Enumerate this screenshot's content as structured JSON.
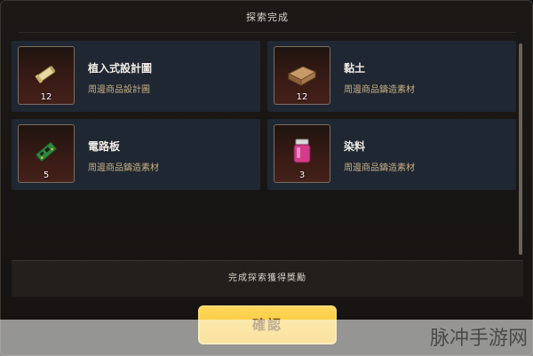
{
  "dialog": {
    "title": "探索完成"
  },
  "items": [
    {
      "name": "植入式設計圖",
      "desc": "周邊商品設計圖",
      "count": "12",
      "icon": "blueprint-scroll-icon"
    },
    {
      "name": "黏土",
      "desc": "周邊商品鑄造素材",
      "count": "12",
      "icon": "clay-block-icon"
    },
    {
      "name": "電路板",
      "desc": "周邊商品鑄造素材",
      "count": "5",
      "icon": "circuit-board-icon"
    },
    {
      "name": "染料",
      "desc": "周邊商品鑄造素材",
      "count": "3",
      "icon": "dye-bottle-icon"
    }
  ],
  "reward_bar": {
    "label": "完成探索獲得獎勵"
  },
  "confirm_button": {
    "label": "確認"
  },
  "watermark": {
    "text": "脉冲手游网"
  },
  "colors": {
    "card_bg": "#1f2733",
    "confirm_yellow": "#f3bf2a",
    "desc_tan": "#c8ae82"
  }
}
